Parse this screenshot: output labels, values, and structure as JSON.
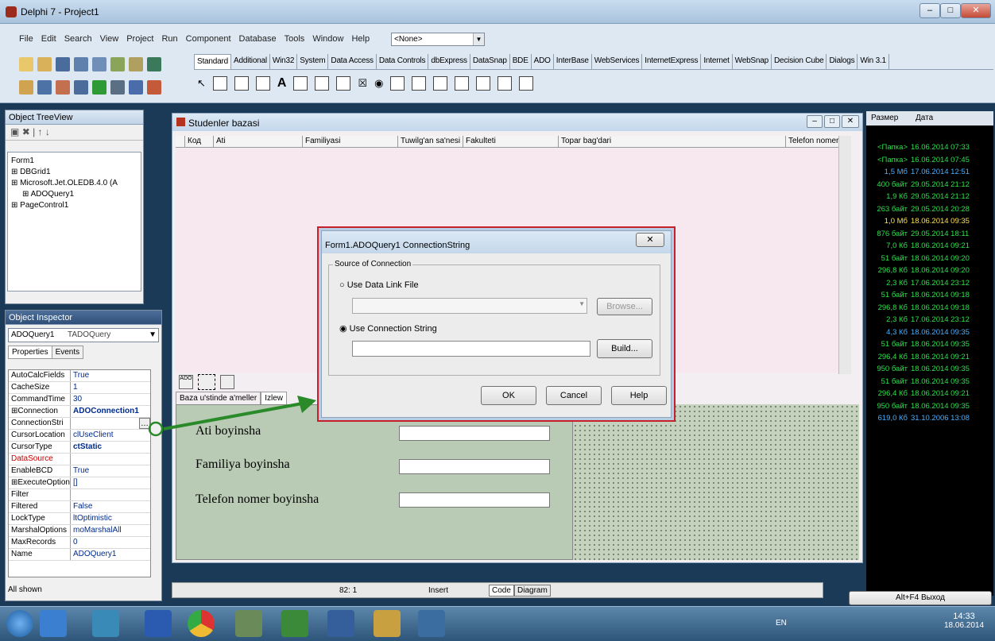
{
  "window": {
    "title": "Delphi 7 - Project1"
  },
  "menu": [
    "File",
    "Edit",
    "Search",
    "View",
    "Project",
    "Run",
    "Component",
    "Database",
    "Tools",
    "Window",
    "Help"
  ],
  "desktop_combo": "<None>",
  "palette_tabs": [
    "Standard",
    "Additional",
    "Win32",
    "System",
    "Data Access",
    "Data Controls",
    "dbExpress",
    "DataSnap",
    "BDE",
    "ADO",
    "InterBase",
    "WebServices",
    "InternetExpress",
    "Internet",
    "WebSnap",
    "Decision Cube",
    "Dialogs",
    "Win 3.1"
  ],
  "active_palette_tab": "Standard",
  "tree_view": {
    "title": "Object TreeView",
    "items": [
      "Form1",
      "DBGrid1",
      "Microsoft.Jet.OLEDB.4.0 (A",
      "ADOQuery1",
      "PageControl1"
    ]
  },
  "inspector": {
    "title": "Object Inspector",
    "object": "ADOQuery1",
    "object_type": "TADOQuery",
    "tabs": [
      "Properties",
      "Events"
    ],
    "rows": [
      {
        "k": "AutoCalcFields",
        "v": "True"
      },
      {
        "k": "CacheSize",
        "v": "1"
      },
      {
        "k": "CommandTime",
        "v": "30"
      },
      {
        "k": "⊞Connection",
        "v": "ADOConnection1"
      },
      {
        "k": "ConnectionStri",
        "v": ""
      },
      {
        "k": "CursorLocation",
        "v": "clUseClient"
      },
      {
        "k": "CursorType",
        "v": "ctStatic"
      },
      {
        "k": "DataSource",
        "v": ""
      },
      {
        "k": "EnableBCD",
        "v": "True"
      },
      {
        "k": "⊞ExecuteOption",
        "v": "[]"
      },
      {
        "k": "Filter",
        "v": ""
      },
      {
        "k": "Filtered",
        "v": "False"
      },
      {
        "k": "LockType",
        "v": "ltOptimistic"
      },
      {
        "k": "MarshalOptions",
        "v": "moMarshalAll"
      },
      {
        "k": "MaxRecords",
        "v": "0"
      },
      {
        "k": "Name",
        "v": "ADOQuery1"
      }
    ],
    "footer": "All shown"
  },
  "form": {
    "title": "Studenler bazasi",
    "columns": [
      "Код",
      "Ati",
      "Familiyasi",
      "Tuwilg'an sa'nesi",
      "Fakulteti",
      "Topar bag'dari",
      "Telefon nomeri"
    ],
    "page_tabs": [
      "Baza u'stinde a'meller",
      "Izlew"
    ],
    "search_labels": [
      "Ati boyinsha",
      "Familiya boyinsha",
      "Telefon nomer boyinsha"
    ],
    "component_label": "ADO"
  },
  "dialog": {
    "title": "Form1.ADOQuery1 ConnectionString",
    "group": "Source of Connection",
    "option1": "Use Data Link File",
    "option2": "Use Connection String",
    "browse": "Browse...",
    "build": "Build...",
    "ok": "OK",
    "cancel": "Cancel",
    "help": "Help"
  },
  "status": {
    "pos": "82: 1",
    "mode": "Insert",
    "tabs": [
      "Code",
      "Diagram"
    ]
  },
  "file_panel": {
    "headers": [
      "Размер",
      "Дата"
    ],
    "rows": [
      {
        "s": "<Папка>",
        "d": "16.06.2014 07:33"
      },
      {
        "s": "<Папка>",
        "d": "16.06.2014 07:45"
      },
      {
        "s": "1,5 Мб",
        "d": "17.06.2014 12:51"
      },
      {
        "s": "400 байт",
        "d": "29.05.2014 21:12"
      },
      {
        "s": "1,9 Кб",
        "d": "29.05.2014 21:12"
      },
      {
        "s": "263 байт",
        "d": "29.05.2014 20:28"
      },
      {
        "s": "1,0 Мб",
        "d": "18.06.2014 09:35"
      },
      {
        "s": "876 байт",
        "d": "29.05.2014 18:11"
      },
      {
        "s": "7,0 Кб",
        "d": "18.06.2014 09:21"
      },
      {
        "s": "51 байт",
        "d": "18.06.2014 09:20"
      },
      {
        "s": "296,8 Кб",
        "d": "18.06.2014 09:20"
      },
      {
        "s": "2,3 Кб",
        "d": "17.06.2014 23:12"
      },
      {
        "s": "51 байт",
        "d": "18.06.2014 09:18"
      },
      {
        "s": "296,8 Кб",
        "d": "18.06.2014 09:18"
      },
      {
        "s": "2,3 Кб",
        "d": "17.06.2014 23:12"
      },
      {
        "s": "4,3 Кб",
        "d": "18.06.2014 09:35"
      },
      {
        "s": "51 байт",
        "d": "18.06.2014 09:35"
      },
      {
        "s": "296,4 Кб",
        "d": "18.06.2014 09:21"
      },
      {
        "s": "950 байт",
        "d": "18.06.2014 09:35"
      },
      {
        "s": "51 байт",
        "d": "18.06.2014 09:35"
      },
      {
        "s": "296,4 Кб",
        "d": "18.06.2014 09:21"
      },
      {
        "s": "950 байт",
        "d": "18.06.2014 09:35"
      },
      {
        "s": "619,0 Кб",
        "d": "31.10.2006 13:08"
      }
    ],
    "footer_btn": "Alt+F4 Выход"
  },
  "taskbar": {
    "lang": "EN",
    "time": "14:33",
    "date": "18.06.2014"
  },
  "colors": {
    "accent": "#c8202a",
    "arrow": "#2a8a2a"
  }
}
